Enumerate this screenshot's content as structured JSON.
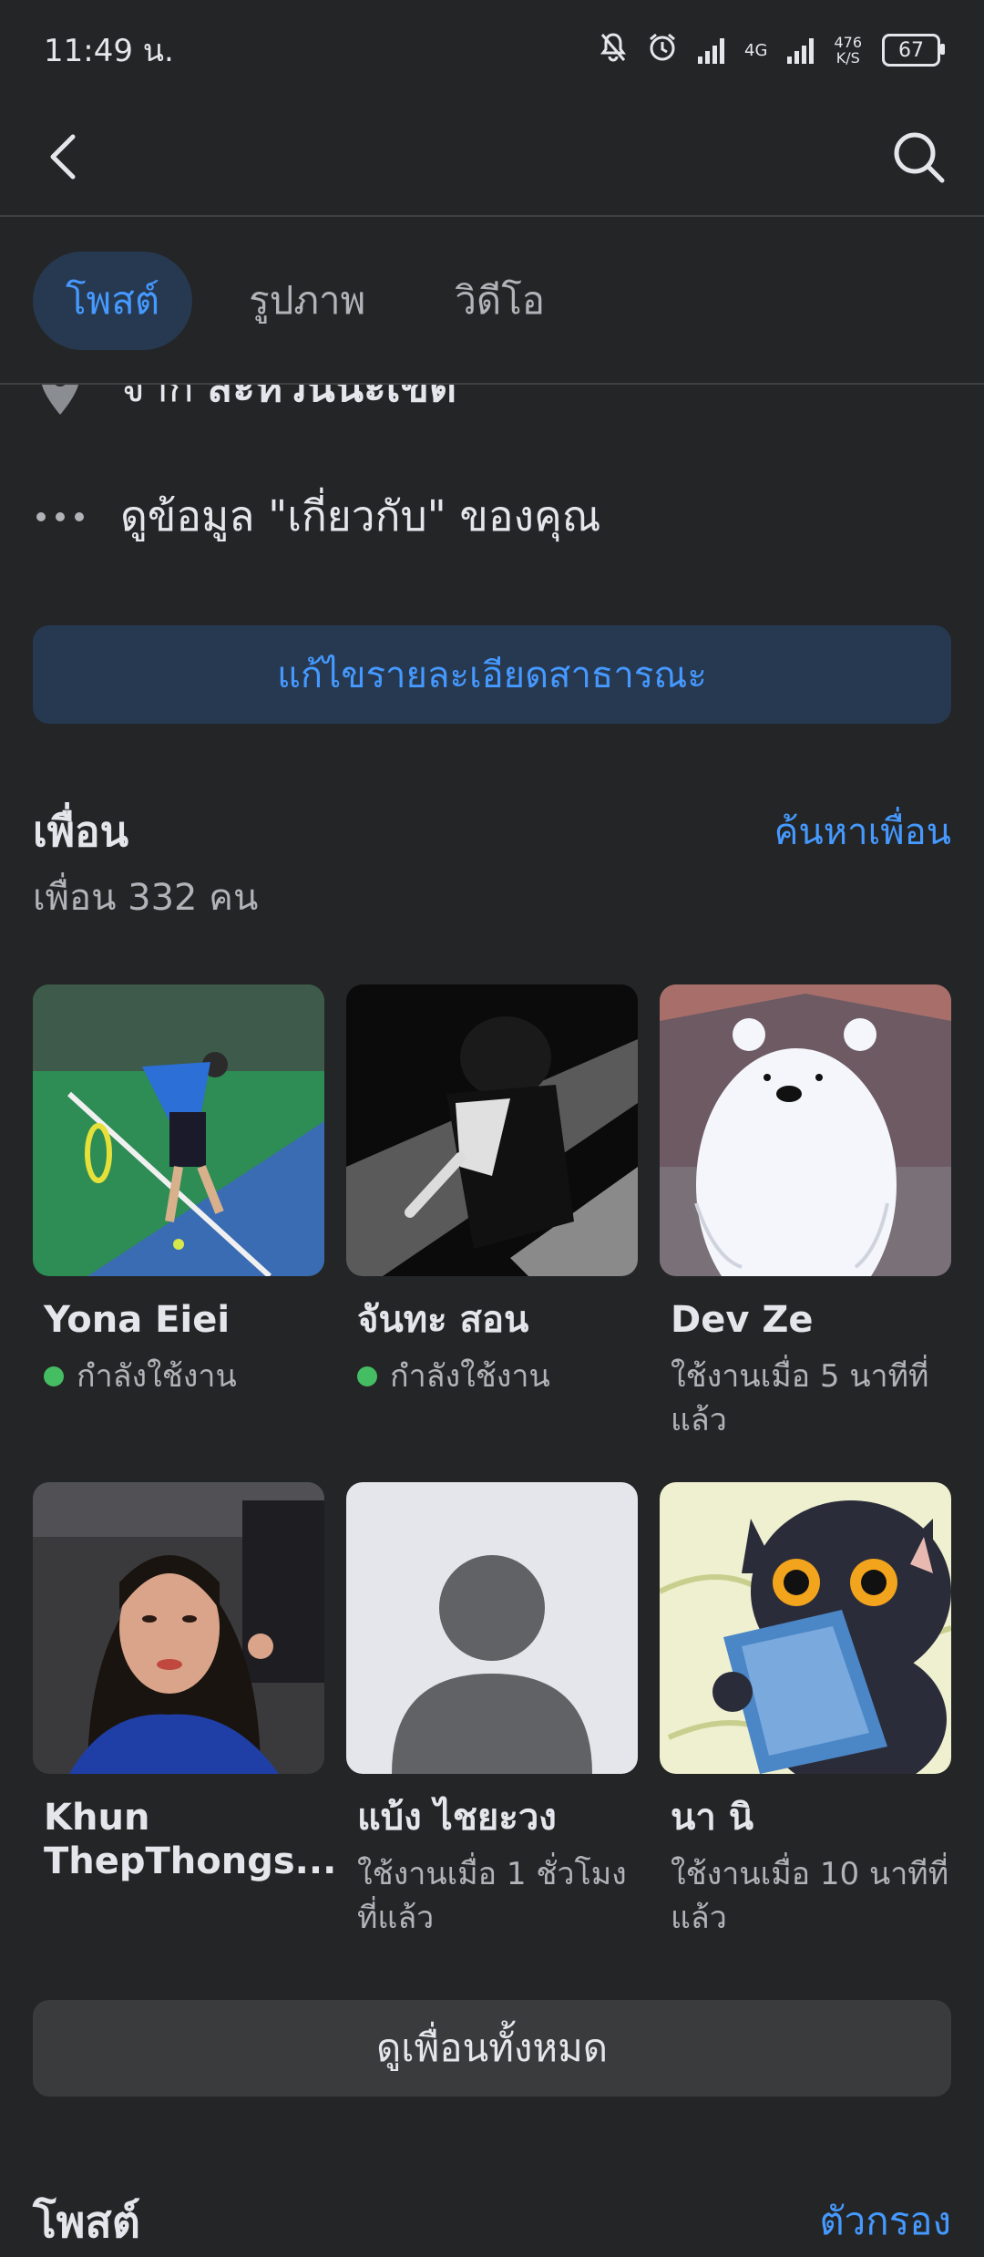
{
  "status_bar": {
    "time": "11:49 น.",
    "network": "4G",
    "net_speed_value": "476",
    "net_speed_unit": "K/S",
    "battery": "67"
  },
  "tabs": [
    {
      "label": "โพสต์",
      "active": true
    },
    {
      "label": "รูปภาพ",
      "active": false
    },
    {
      "label": "วิดีโอ",
      "active": false
    }
  ],
  "about": {
    "from_prefix": "จาก",
    "from_place": "สะหวันนะเขต",
    "view_about": "ดูข้อมูล \"เกี่ยวกับ\" ของคุณ"
  },
  "edit_public_details": "แก้ไขรายละเอียดสาธารณะ",
  "friends": {
    "title": "เพื่อน",
    "find_link": "ค้นหาเพื่อน",
    "count_text": "เพื่อน 332 คน",
    "items": [
      {
        "name": "Yona Eiei",
        "status": "กำลังใช้งาน",
        "online": true
      },
      {
        "name": "จันทะ สอน",
        "status": "กำลังใช้งาน",
        "online": true
      },
      {
        "name": "Dev Ze",
        "status": "ใช้งานเมื่อ 5 นาทีที่แล้ว",
        "online": false
      },
      {
        "name": "Khun ThepThongs...",
        "status": "",
        "online": false
      },
      {
        "name": "แบ้ง ไชยะวง",
        "status": "ใช้งานเมื่อ 1 ชั่วโมงที่แล้ว",
        "online": false
      },
      {
        "name": "นา นิ",
        "status": "ใช้งานเมื่อ 10 นาทีที่แล้ว",
        "online": false
      }
    ],
    "see_all": "ดูเพื่อนทั้งหมด"
  },
  "posts": {
    "title": "โพสต์",
    "filter_link": "ตัวกรอง"
  },
  "colors": {
    "background": "#242526",
    "accent": "#4599ff",
    "accent_bg": "#263951",
    "online": "#45bd62"
  }
}
